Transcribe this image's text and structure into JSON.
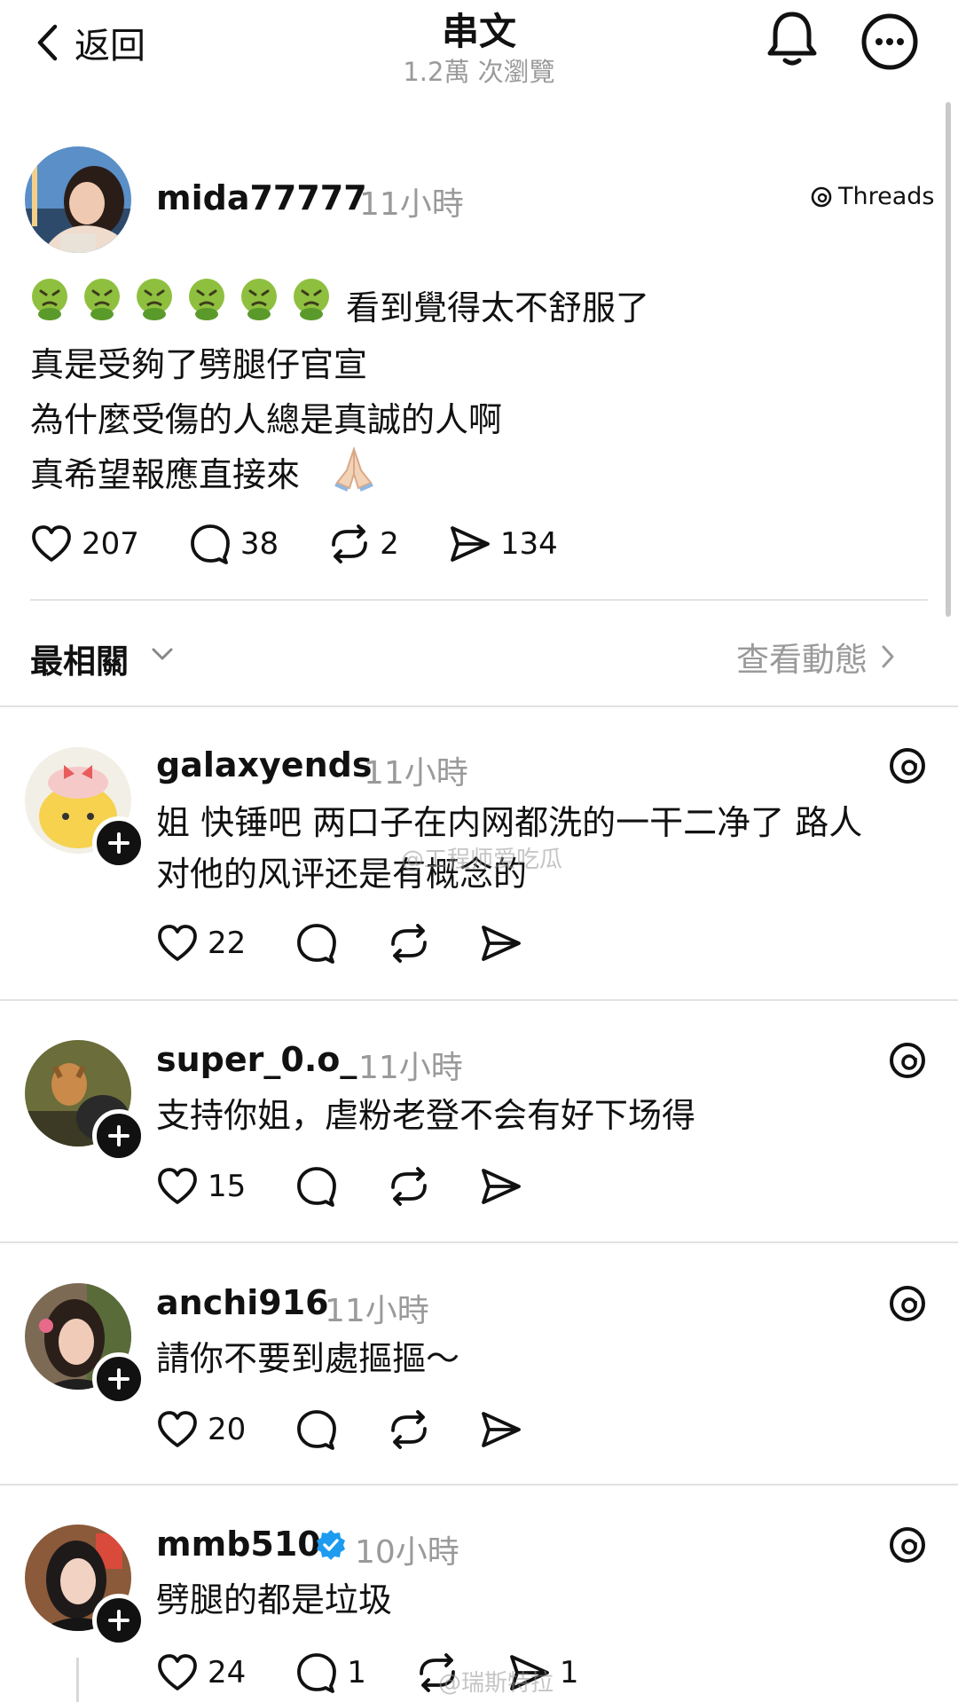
{
  "header": {
    "back_label": "返回",
    "title": "串文",
    "views": "1.2萬 次瀏覽"
  },
  "post": {
    "username": "mida77777",
    "time": "11小時",
    "badge": "Threads",
    "emoji_text": "看到覺得太不舒服了",
    "lines": [
      "真是受夠了劈腿仔官宣",
      "為什麼受傷的人總是真誠的人啊",
      "真希望報應直接來"
    ],
    "emoji_icons": [
      "nauseated-face",
      "nauseated-face",
      "nauseated-face",
      "nauseated-face",
      "nauseated-face",
      "nauseated-face"
    ],
    "closing_icon": "folded-hands",
    "likes": "207",
    "replies": "38",
    "reposts": "2",
    "shares": "134"
  },
  "sort": {
    "label": "最相關",
    "activity": "查看動態"
  },
  "comments": [
    {
      "username": "galaxyends",
      "time": "11小時",
      "lines": [
        "姐 快锤吧 两口子在内网都洗的一干二净了 路人",
        "对他的风评还是有概念的"
      ],
      "likes": "22",
      "replies": "",
      "reposts": "",
      "shares": "",
      "avatar": "avatar-yellow-plush"
    },
    {
      "username": "super_0.o_",
      "time": "11小時",
      "lines": [
        "支持你姐，虐粉老登不会有好下场得"
      ],
      "likes": "15",
      "replies": "",
      "reposts": "",
      "shares": "",
      "avatar": "avatar-dog-photo"
    },
    {
      "username": "anchi916",
      "time": "11小時",
      "lines": [
        "請你不要到處摳摳～"
      ],
      "likes": "20",
      "replies": "",
      "reposts": "",
      "shares": "",
      "avatar": "avatar-woman-photo"
    },
    {
      "username": "mmb510",
      "time": "10小時",
      "verified": true,
      "lines": [
        "劈腿的都是垃圾"
      ],
      "likes": "24",
      "replies": "1",
      "reposts": "",
      "shares": "1",
      "avatar": "avatar-woman-photo-2"
    }
  ],
  "watermarks": {
    "top": "@工程师爱吃瓜",
    "bottom": "@瑞斯特拉"
  },
  "colors": {
    "text": "#111111",
    "muted": "#9a9a9a",
    "verified": "#1d9bf0",
    "divider": "#e2e2e2"
  }
}
